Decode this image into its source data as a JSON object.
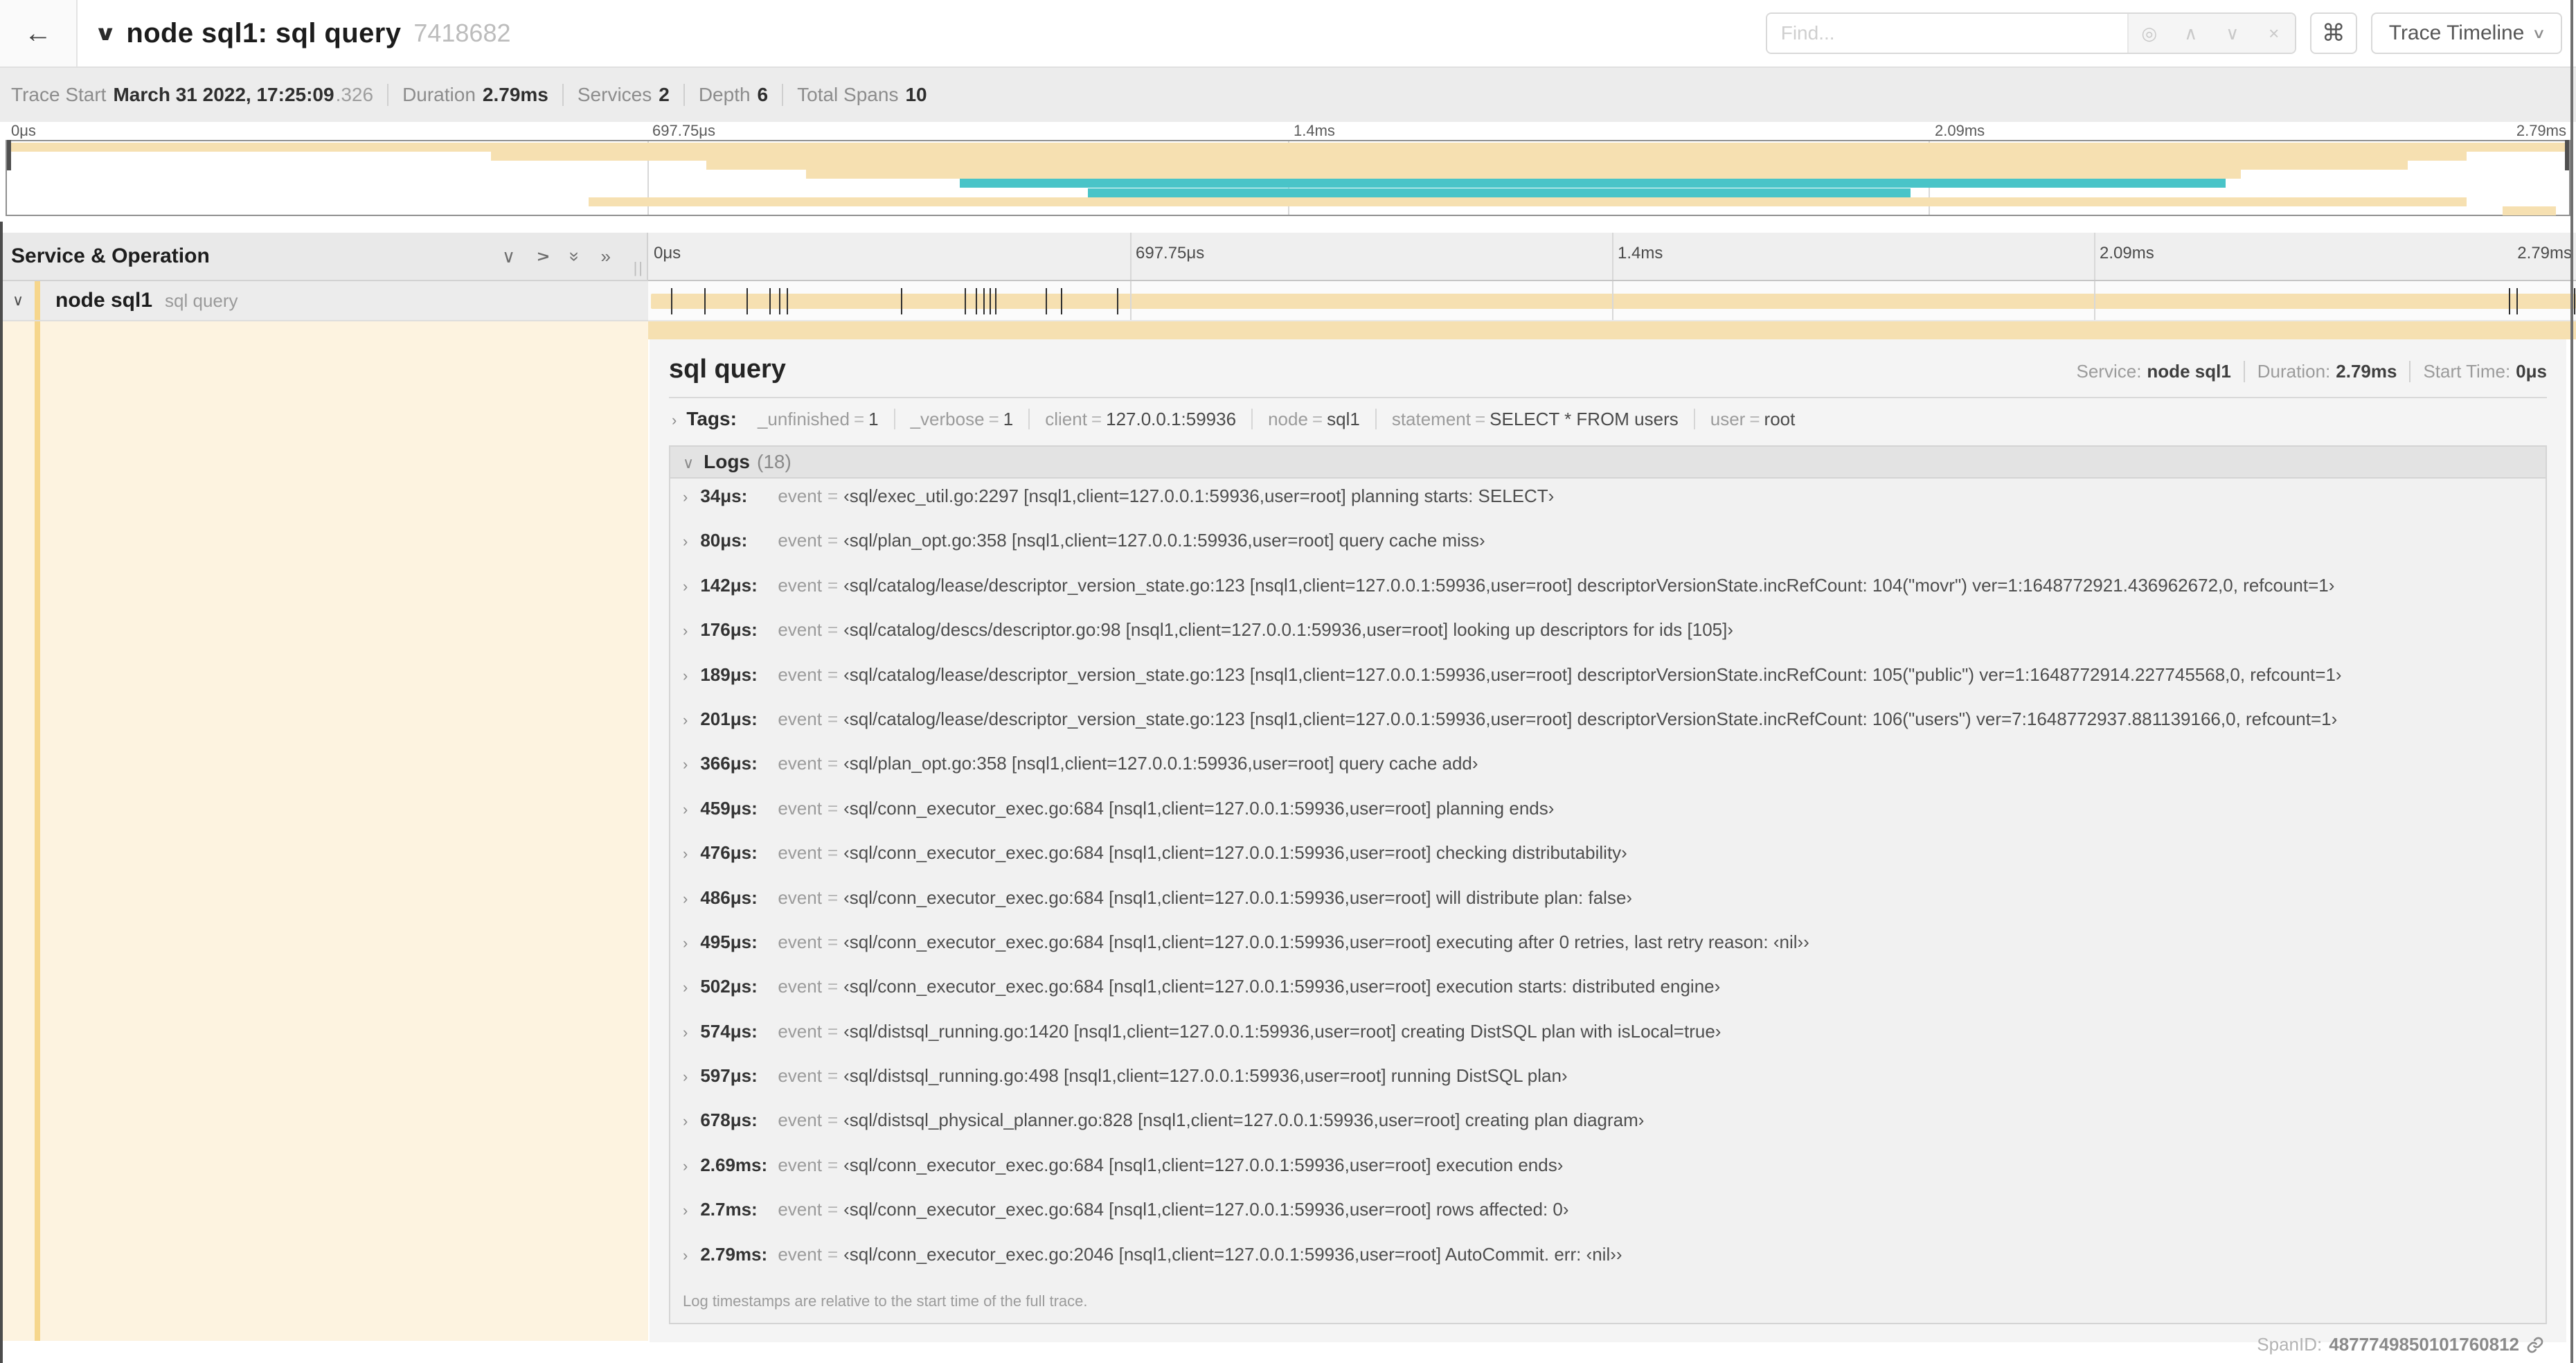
{
  "header": {
    "back_icon": "←",
    "collapse_icon": "∨",
    "title": "node sql1: sql query",
    "trace_id": "7418682",
    "find_placeholder": "Find...",
    "find_buttons": {
      "locate": "◎",
      "prev": "∧",
      "next": "∨",
      "clear": "×"
    },
    "shortcuts_button": "⌘",
    "view_selector": "Trace Timeline"
  },
  "trace_info": {
    "items": [
      {
        "label": "Trace Start",
        "value": "March 31 2022, 17:25:09",
        "suffix": ".326"
      },
      {
        "label": "Duration",
        "value": "2.79ms"
      },
      {
        "label": "Services",
        "value": "2"
      },
      {
        "label": "Depth",
        "value": "6"
      },
      {
        "label": "Total Spans",
        "value": "10"
      }
    ]
  },
  "colors": {
    "span_tan": "#f6e0b1",
    "span_teal": "#49c4c8",
    "detail_cream": "#fdf3e0",
    "stripe_tan": "#f6d68c"
  },
  "timeline": {
    "tick_labels": [
      {
        "text": "0μs",
        "pct": 0
      },
      {
        "text": "697.75μs",
        "pct": 25
      },
      {
        "text": "1.4ms",
        "pct": 50
      },
      {
        "text": "2.09ms",
        "pct": 75
      },
      {
        "text": "2.79ms",
        "pct": 100
      }
    ],
    "gridline_pcts": [
      25,
      50,
      75
    ],
    "minimap_bars": [
      {
        "left": 0,
        "width": 100,
        "color": "span_tan"
      },
      {
        "left": 18.9,
        "width": 77.1,
        "color": "span_tan"
      },
      {
        "left": 27.3,
        "width": 66.4,
        "color": "span_tan"
      },
      {
        "left": 31.2,
        "width": 56.0,
        "color": "span_tan"
      },
      {
        "left": 37.2,
        "width": 49.4,
        "color": "span_teal"
      },
      {
        "left": 42.2,
        "width": 32.1,
        "color": "span_teal"
      },
      {
        "left": 22.7,
        "width": 73.3,
        "color": "span_tan"
      },
      {
        "left": 97.4,
        "width": 2.1,
        "color": "span_tan"
      }
    ],
    "left_header": "Service & Operation",
    "header_icons": {
      "collapse_one": "∨",
      "expand_one": "∨",
      "collapse_all": "»",
      "expand_all": "»"
    },
    "column_grip": "||",
    "span_row": {
      "chevron": "∨",
      "service": "node sql1",
      "operation": "sql query",
      "log_marker_pcts": [
        1.2,
        2.9,
        5.1,
        6.3,
        6.8,
        7.2,
        13.1,
        16.4,
        17.0,
        17.4,
        17.7,
        18.0,
        20.6,
        21.4,
        24.3,
        96.5,
        96.9,
        99.9
      ]
    }
  },
  "detail": {
    "operation": "sql query",
    "meta": [
      {
        "label": "Service:",
        "value": "node sql1"
      },
      {
        "label": "Duration:",
        "value": "2.79ms"
      },
      {
        "label": "Start Time:",
        "value": "0μs"
      }
    ],
    "tags_chevron": "›",
    "tags_label": "Tags:",
    "tags": [
      {
        "key": "_unfinished",
        "value": "1"
      },
      {
        "key": "_verbose",
        "value": "1"
      },
      {
        "key": "client",
        "value": "127.0.0.1:59936"
      },
      {
        "key": "node",
        "value": "sql1"
      },
      {
        "key": "statement",
        "value": "SELECT * FROM users"
      },
      {
        "key": "user",
        "value": "root"
      }
    ],
    "logs_chevron": "∨",
    "logs_label": "Logs",
    "logs_count": "(18)",
    "log_field_key": "event",
    "logs": [
      {
        "time": "34μs:",
        "value": "‹sql/exec_util.go:2297 [nsql1,client=127.0.0.1:59936,user=root] planning starts: SELECT›"
      },
      {
        "time": "80μs:",
        "value": "‹sql/plan_opt.go:358 [nsql1,client=127.0.0.1:59936,user=root] query cache miss›"
      },
      {
        "time": "142μs:",
        "value": "‹sql/catalog/lease/descriptor_version_state.go:123 [nsql1,client=127.0.0.1:59936,user=root] descriptorVersionState.incRefCount: 104(\"movr\") ver=1:1648772921.436962672,0, refcount=1›"
      },
      {
        "time": "176μs:",
        "value": "‹sql/catalog/descs/descriptor.go:98 [nsql1,client=127.0.0.1:59936,user=root] looking up descriptors for ids [105]›"
      },
      {
        "time": "189μs:",
        "value": "‹sql/catalog/lease/descriptor_version_state.go:123 [nsql1,client=127.0.0.1:59936,user=root] descriptorVersionState.incRefCount: 105(\"public\") ver=1:1648772914.227745568,0, refcount=1›"
      },
      {
        "time": "201μs:",
        "value": "‹sql/catalog/lease/descriptor_version_state.go:123 [nsql1,client=127.0.0.1:59936,user=root] descriptorVersionState.incRefCount: 106(\"users\") ver=7:1648772937.881139166,0, refcount=1›"
      },
      {
        "time": "366μs:",
        "value": "‹sql/plan_opt.go:358 [nsql1,client=127.0.0.1:59936,user=root] query cache add›"
      },
      {
        "time": "459μs:",
        "value": "‹sql/conn_executor_exec.go:684 [nsql1,client=127.0.0.1:59936,user=root] planning ends›"
      },
      {
        "time": "476μs:",
        "value": "‹sql/conn_executor_exec.go:684 [nsql1,client=127.0.0.1:59936,user=root] checking distributability›"
      },
      {
        "time": "486μs:",
        "value": "‹sql/conn_executor_exec.go:684 [nsql1,client=127.0.0.1:59936,user=root] will distribute plan: false›"
      },
      {
        "time": "495μs:",
        "value": "‹sql/conn_executor_exec.go:684 [nsql1,client=127.0.0.1:59936,user=root] executing after 0 retries, last retry reason: ‹nil››"
      },
      {
        "time": "502μs:",
        "value": "‹sql/conn_executor_exec.go:684 [nsql1,client=127.0.0.1:59936,user=root] execution starts: distributed engine›"
      },
      {
        "time": "574μs:",
        "value": "‹sql/distsql_running.go:1420 [nsql1,client=127.0.0.1:59936,user=root] creating DistSQL plan with isLocal=true›"
      },
      {
        "time": "597μs:",
        "value": "‹sql/distsql_running.go:498 [nsql1,client=127.0.0.1:59936,user=root] running DistSQL plan›"
      },
      {
        "time": "678μs:",
        "value": "‹sql/distsql_physical_planner.go:828 [nsql1,client=127.0.0.1:59936,user=root] creating plan diagram›"
      },
      {
        "time": "2.69ms:",
        "value": "‹sql/conn_executor_exec.go:684 [nsql1,client=127.0.0.1:59936,user=root] execution ends›"
      },
      {
        "time": "2.7ms:",
        "value": "‹sql/conn_executor_exec.go:684 [nsql1,client=127.0.0.1:59936,user=root] rows affected: 0›"
      },
      {
        "time": "2.79ms:",
        "value": "‹sql/conn_executor_exec.go:2046 [nsql1,client=127.0.0.1:59936,user=root] AutoCommit. err: ‹nil››"
      }
    ],
    "logs_note": "Log timestamps are relative to the start time of the full trace.",
    "span_id_label": "SpanID:",
    "span_id": "4877749850101760812"
  }
}
